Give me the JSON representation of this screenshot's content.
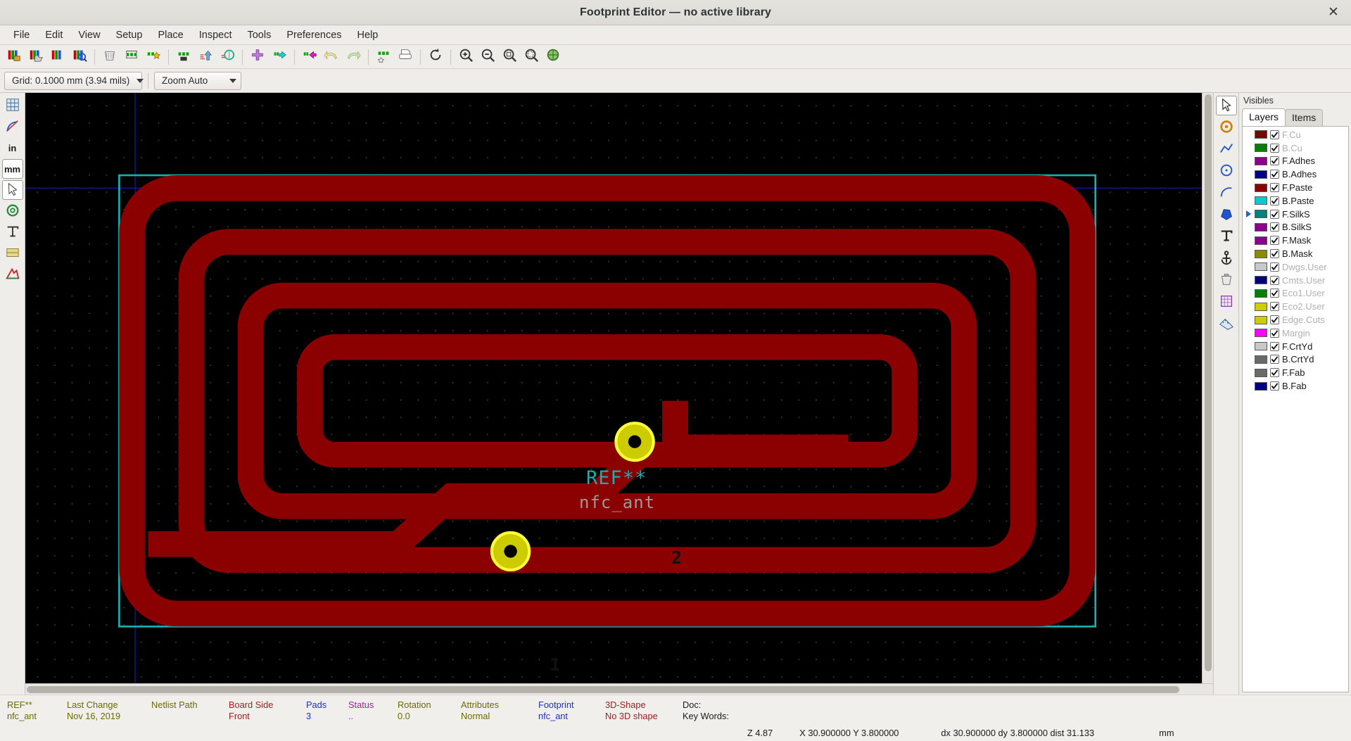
{
  "window": {
    "title": "Footprint Editor — no active library",
    "close_label": "✕"
  },
  "menubar": {
    "items": [
      {
        "label": "File"
      },
      {
        "label": "Edit"
      },
      {
        "label": "View"
      },
      {
        "label": "Setup"
      },
      {
        "label": "Place"
      },
      {
        "label": "Inspect"
      },
      {
        "label": "Tools"
      },
      {
        "label": "Preferences"
      },
      {
        "label": "Help"
      }
    ]
  },
  "toolbar": {
    "buttons": [
      {
        "name": "new-library-icon",
        "tip": "New Library"
      },
      {
        "name": "open-library-icon",
        "tip": "Open Library"
      },
      {
        "name": "save-library-icon",
        "tip": "Save Library"
      },
      {
        "name": "library-browser-icon",
        "tip": "Library Browser"
      },
      {
        "name": "delete-footprint-icon",
        "tip": "Delete Footprint"
      },
      {
        "name": "new-footprint-icon",
        "tip": "New Footprint"
      },
      {
        "name": "new-footprint-wizard-icon",
        "tip": "New Footprint Wizard"
      },
      {
        "name": "save-footprint-icon",
        "tip": "Save Footprint"
      },
      {
        "name": "import-footprint-icon",
        "tip": "Import Footprint"
      },
      {
        "name": "export-footprint-icon",
        "tip": "Export Footprint"
      },
      {
        "name": "add-footprint-icon",
        "tip": "Add Footprint"
      },
      {
        "name": "footprint-from-board-icon",
        "tip": "Load Footprint from Board"
      },
      {
        "name": "footprint-to-board-icon",
        "tip": "Update Footprint on Board"
      },
      {
        "name": "undo-icon",
        "tip": "Undo"
      },
      {
        "name": "redo-icon",
        "tip": "Redo"
      },
      {
        "name": "footprint-properties-icon",
        "tip": "Footprint Properties"
      },
      {
        "name": "print-icon",
        "tip": "Print"
      },
      {
        "name": "refresh-icon",
        "tip": "Refresh"
      },
      {
        "name": "zoom-in-icon",
        "tip": "Zoom In"
      },
      {
        "name": "zoom-out-icon",
        "tip": "Zoom Out"
      },
      {
        "name": "zoom-fit-icon",
        "tip": "Zoom to Fit"
      },
      {
        "name": "zoom-area-icon",
        "tip": "Zoom to Selection"
      },
      {
        "name": "measure-icon",
        "tip": "Measure Tool"
      }
    ]
  },
  "auxbar": {
    "grid_label": "Grid: 0.1000 mm (3.94 mils)",
    "zoom_label": "Zoom Auto"
  },
  "lefttools": {
    "buttons": [
      {
        "name": "toggle-grid-icon",
        "label": "",
        "active": false
      },
      {
        "name": "toggle-polar-coords-icon",
        "label": "",
        "active": false
      },
      {
        "name": "units-inches-icon",
        "label": "in",
        "active": false
      },
      {
        "name": "units-mm-icon",
        "label": "mm",
        "active": true
      },
      {
        "name": "toggle-cursor-icon",
        "label": "",
        "active": true
      },
      {
        "name": "show-pads-sketch-icon",
        "label": "",
        "active": false
      },
      {
        "name": "show-text-sketch-icon",
        "label": "",
        "active": false
      },
      {
        "name": "show-graphics-sketch-icon",
        "label": "",
        "active": false
      },
      {
        "name": "high-contrast-mode-icon",
        "label": "",
        "active": false
      }
    ]
  },
  "righttools": {
    "buttons": [
      {
        "name": "select-tool-icon",
        "active": true
      },
      {
        "name": "add-pad-icon",
        "active": false
      },
      {
        "name": "draw-line-icon",
        "active": false
      },
      {
        "name": "draw-circle-icon",
        "active": false
      },
      {
        "name": "draw-arc-icon",
        "active": false
      },
      {
        "name": "draw-polygon-icon",
        "active": false
      },
      {
        "name": "add-text-icon",
        "active": false
      },
      {
        "name": "set-anchor-icon",
        "active": false
      },
      {
        "name": "delete-tool-icon",
        "active": false
      },
      {
        "name": "set-grid-origin-icon",
        "active": false
      },
      {
        "name": "measure-tool-icon",
        "active": false
      }
    ]
  },
  "sidepanel": {
    "title": "Visibles",
    "tabs": [
      {
        "label": "Layers",
        "active": true
      },
      {
        "label": "Items",
        "active": false
      }
    ],
    "layers": [
      {
        "label": "F.Cu",
        "color": "#7f0000",
        "checked": true,
        "dim": true,
        "selected": false
      },
      {
        "label": "B.Cu",
        "color": "#008000",
        "checked": true,
        "dim": true,
        "selected": false
      },
      {
        "label": "F.Adhes",
        "color": "#8b008b",
        "checked": true,
        "dim": false,
        "selected": false
      },
      {
        "label": "B.Adhes",
        "color": "#000080",
        "checked": true,
        "dim": false,
        "selected": false
      },
      {
        "label": "F.Paste",
        "color": "#8b0000",
        "checked": true,
        "dim": false,
        "selected": false
      },
      {
        "label": "B.Paste",
        "color": "#00cdcd",
        "checked": true,
        "dim": false,
        "selected": false
      },
      {
        "label": "F.SilkS",
        "color": "#008080",
        "checked": true,
        "dim": false,
        "selected": true
      },
      {
        "label": "B.SilkS",
        "color": "#8b008b",
        "checked": true,
        "dim": false,
        "selected": false
      },
      {
        "label": "F.Mask",
        "color": "#8b008b",
        "checked": true,
        "dim": false,
        "selected": false
      },
      {
        "label": "B.Mask",
        "color": "#8b8b00",
        "checked": true,
        "dim": false,
        "selected": false
      },
      {
        "label": "Dwgs.User",
        "color": "#c8c8c8",
        "checked": true,
        "dim": true,
        "selected": false
      },
      {
        "label": "Cmts.User",
        "color": "#000080",
        "checked": true,
        "dim": true,
        "selected": false
      },
      {
        "label": "Eco1.User",
        "color": "#008000",
        "checked": true,
        "dim": true,
        "selected": false
      },
      {
        "label": "Eco2.User",
        "color": "#cdcd00",
        "checked": true,
        "dim": true,
        "selected": false
      },
      {
        "label": "Edge.Cuts",
        "color": "#cdcd00",
        "checked": true,
        "dim": true,
        "selected": false
      },
      {
        "label": "Margin",
        "color": "#ff00ff",
        "checked": true,
        "dim": true,
        "selected": false
      },
      {
        "label": "F.CrtYd",
        "color": "#c8c8c8",
        "checked": true,
        "dim": false,
        "selected": false
      },
      {
        "label": "B.CrtYd",
        "color": "#696969",
        "checked": true,
        "dim": false,
        "selected": false
      },
      {
        "label": "F.Fab",
        "color": "#696969",
        "checked": true,
        "dim": false,
        "selected": false
      },
      {
        "label": "B.Fab",
        "color": "#000080",
        "checked": true,
        "dim": false,
        "selected": false
      }
    ]
  },
  "canvas": {
    "reference_text": "REF**",
    "value_text": "nfc_ant",
    "pads": [
      {
        "number": "1"
      },
      {
        "number": "2"
      }
    ],
    "colors": {
      "copper": "#8b0000",
      "silkscreen": "#17b0b0",
      "courtyard": "#9a9a9a",
      "margin": "#0000c0",
      "background": "#000000"
    }
  },
  "status": {
    "fields": [
      {
        "key": "REF**",
        "value": "nfc_ant",
        "key_color": "#6b6b00",
        "value_color": "#6b6b00"
      },
      {
        "key": "Last Change",
        "value": "Nov 16, 2019",
        "key_color": "#6b6b00",
        "value_color": "#6b6b00"
      },
      {
        "key": "Netlist Path",
        "value": "",
        "key_color": "#6b6b00",
        "value_color": "#6b6b00"
      },
      {
        "key": "Board Side",
        "value": "Front",
        "key_color": "#a02020",
        "value_color": "#a02020"
      },
      {
        "key": "Pads",
        "value": "3",
        "key_color": "#2030c0",
        "value_color": "#2030c0"
      },
      {
        "key": "Status",
        "value": "..",
        "key_color": "#a020a0",
        "value_color": "#a020a0"
      },
      {
        "key": "Rotation",
        "value": "0.0",
        "key_color": "#6b6b00",
        "value_color": "#6b6b00"
      },
      {
        "key": "Attributes",
        "value": "Normal",
        "key_color": "#6b6b00",
        "value_color": "#6b6b00"
      },
      {
        "key": "Footprint",
        "value": "nfc_ant",
        "key_color": "#2030c0",
        "value_color": "#2030c0"
      },
      {
        "key": "3D-Shape",
        "value": "No 3D shape",
        "key_color": "#a02020",
        "value_color": "#a02020"
      },
      {
        "key": "Doc:",
        "value": "Key Words:",
        "key_color": "#1a1a1a",
        "value_color": "#1a1a1a"
      }
    ],
    "bottom": {
      "zoom": "Z 4.87",
      "coords": "X 30.900000  Y 3.800000",
      "deltas": "dx 30.900000 dy 3.800000 dist 31.133",
      "units": "mm"
    }
  }
}
